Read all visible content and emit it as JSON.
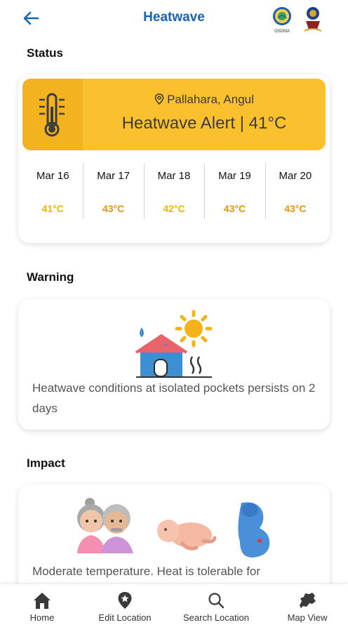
{
  "header": {
    "title": "Heatwave",
    "back_icon": "back-arrow-icon",
    "logos": [
      "osdma-logo",
      "emblem-logo"
    ],
    "logo_text": "OSDMA"
  },
  "status": {
    "heading": "Status",
    "location": "Pallahara, Angul",
    "alert": "Heatwave Alert | 41°C",
    "colors": {
      "alert_bg": "#fbc02d",
      "temp_yellow": "#f4b400",
      "temp_orange": "#e69512"
    },
    "forecast": [
      {
        "date": "Mar 16",
        "temp": "41°C",
        "color": "#f4b400"
      },
      {
        "date": "Mar 17",
        "temp": "43°C",
        "color": "#e69512"
      },
      {
        "date": "Mar 18",
        "temp": "42°C",
        "color": "#f4b400"
      },
      {
        "date": "Mar 19",
        "temp": "43°C",
        "color": "#e69512"
      },
      {
        "date": "Mar 20",
        "temp": "43°C",
        "color": "#e69512"
      }
    ]
  },
  "warning": {
    "heading": "Warning",
    "text": "Heatwave conditions at isolated pockets persists on 2 days"
  },
  "impact": {
    "heading": "Impact",
    "text": "Moderate temperature. Heat is tolerable for"
  },
  "nav": {
    "items": [
      {
        "label": "Home",
        "icon": "home-icon"
      },
      {
        "label": "Edit Location",
        "icon": "location-pin-icon"
      },
      {
        "label": "Search Location",
        "icon": "search-icon"
      },
      {
        "label": "Map View",
        "icon": "map-icon"
      }
    ]
  }
}
